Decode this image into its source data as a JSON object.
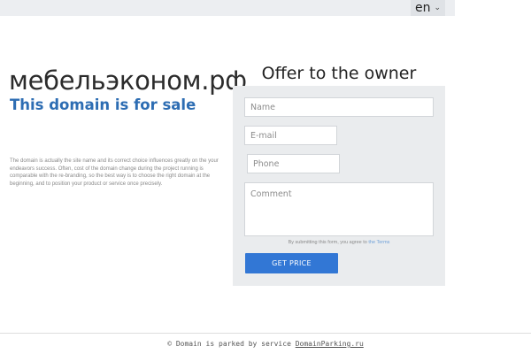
{
  "language": {
    "current": "en"
  },
  "domain": {
    "name": "мебельэконом.рф",
    "sale_label": "This domain is for sale",
    "description": "The domain is actually the site name and its correct choice influences greatly on the your endeavors success. Often, cost of the domain change during the project running is comparable with the re-branding, so the best way is to choose the right domain at the beginning, and to position your product or service once precisely."
  },
  "offer_form": {
    "title": "Offer to the owner",
    "name_placeholder": "Name",
    "email_placeholder": "E-mail",
    "phone_placeholder": "Phone",
    "comment_placeholder": "Comment",
    "terms_prefix": "By submitting this form, you agree to",
    "terms_link": "the Terms",
    "submit_label": "GET PRICE"
  },
  "footer": {
    "prefix": "© Domain is parked by service",
    "link": "DomainParking.ru"
  },
  "colors": {
    "accent": "#3277d5",
    "sale_text": "#2d6db3",
    "panel_bg": "#eaecee"
  }
}
